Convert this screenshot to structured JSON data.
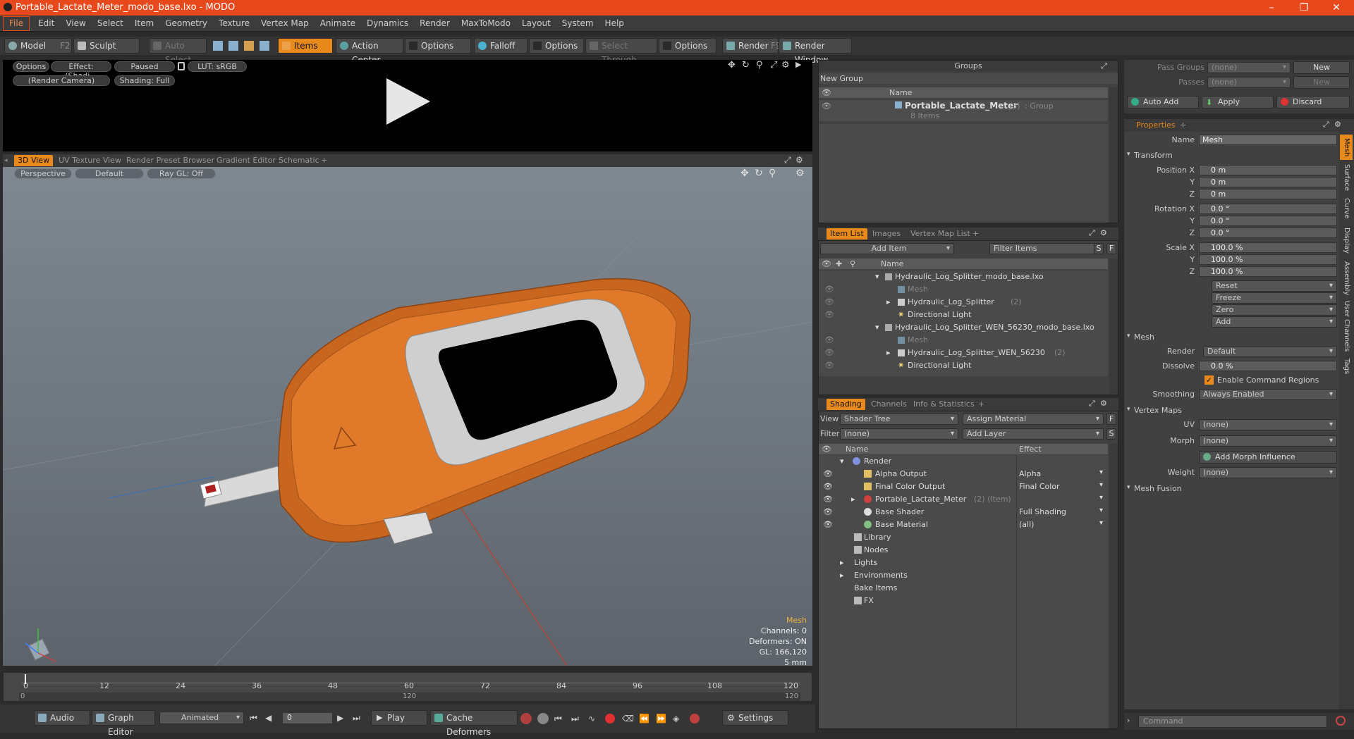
{
  "window": {
    "title": "Portable_Lactate_Meter_modo_base.lxo - MODO"
  },
  "menu": [
    "File",
    "Edit",
    "View",
    "Select",
    "Item",
    "Geometry",
    "Texture",
    "Vertex Map",
    "Animate",
    "Dynamics",
    "Render",
    "MaxToModo",
    "Layout",
    "System",
    "Help"
  ],
  "toolbar": {
    "model": "Model",
    "model_key": "F2",
    "sculpt": "Sculpt",
    "auto_select": "Auto Select",
    "items": "Items",
    "action_center": "Action Center",
    "options1": "Options",
    "falloff": "Falloff",
    "options2": "Options",
    "select_through": "Select Through",
    "options3": "Options",
    "render": "Render",
    "render_key": "F9",
    "render_window": "Render Window"
  },
  "preview": {
    "options": "Options",
    "effect": "Effect: (Shadi...",
    "paused": "Paused",
    "lut": "LUT: sRGB",
    "camera": "(Render Camera)",
    "shading": "Shading: Full"
  },
  "viewtabs": [
    "3D View",
    "UV Texture View",
    "Render Preset Browser",
    "Gradient Editor",
    "Schematic"
  ],
  "viewport": {
    "perspective": "Perspective",
    "default": "Default",
    "raygl": "Ray GL: Off",
    "info": {
      "title": "Mesh",
      "channels": "Channels: 0",
      "deformers": "Deformers: ON",
      "gl": "GL: 166,120",
      "scale": "5 mm"
    }
  },
  "timeline": {
    "ticks": [
      "0",
      "12",
      "24",
      "36",
      "48",
      "60",
      "72",
      "84",
      "96",
      "108",
      "120"
    ],
    "sub_left": "0",
    "sub_mid": "120",
    "sub_right": "120"
  },
  "bottombar": {
    "audio": "Audio",
    "graph": "Graph Editor",
    "animated": "Animated",
    "frame": "0",
    "play": "Play",
    "cache": "Cache Deformers",
    "settings": "Settings"
  },
  "groups": {
    "title": "Groups",
    "new_group": "New Group",
    "col_name": "Name",
    "item_name": "Portable_Lactate_Meter",
    "item_count": "(3)",
    "item_type": ": Group",
    "item_sub": "8 Items"
  },
  "itemlist": {
    "tabs": [
      "Item List",
      "Images",
      "Vertex Map List"
    ],
    "add_item": "Add Item",
    "filter": "Filter Items",
    "s": "S",
    "f": "F",
    "col_name": "Name",
    "rows": [
      {
        "indent": 0,
        "text": "Hydraulic_Log_Splitter_modo_base.lxo",
        "dim": false,
        "arrow": "▾"
      },
      {
        "indent": 1,
        "text": "Mesh",
        "dim": true,
        "arrow": ""
      },
      {
        "indent": 1,
        "text": "Hydraulic_Log_Splitter",
        "dim": false,
        "arrow": "▸",
        "suffix": "(2)"
      },
      {
        "indent": 1,
        "text": "Directional Light",
        "dim": false,
        "arrow": ""
      },
      {
        "indent": 0,
        "text": "Hydraulic_Log_Splitter_WEN_56230_modo_base.lxo",
        "dim": false,
        "arrow": "▾"
      },
      {
        "indent": 1,
        "text": "Mesh",
        "dim": true,
        "arrow": ""
      },
      {
        "indent": 1,
        "text": "Hydraulic_Log_Splitter_WEN_56230",
        "dim": false,
        "arrow": "▸",
        "suffix": "(2)"
      },
      {
        "indent": 1,
        "text": "Directional Light",
        "dim": false,
        "arrow": ""
      }
    ]
  },
  "shading": {
    "tabs": [
      "Shading",
      "Channels",
      "Info & Statistics"
    ],
    "view_label": "View",
    "view_val": "Shader Tree",
    "assign": "Assign Material",
    "f": "F",
    "filter_label": "Filter",
    "filter_val": "(none)",
    "add_layer": "Add Layer",
    "s": "S",
    "col_name": "Name",
    "col_effect": "Effect",
    "rows": [
      {
        "indent": 0,
        "text": "Render",
        "effect": "",
        "arrow": "▾",
        "eye": false
      },
      {
        "indent": 1,
        "text": "Alpha Output",
        "effect": "Alpha",
        "arrow": "",
        "eye": true
      },
      {
        "indent": 1,
        "text": "Final Color Output",
        "effect": "Final Color",
        "arrow": "",
        "eye": true
      },
      {
        "indent": 1,
        "text": "Portable_Lactate_Meter",
        "suffix": "(2) (Item)",
        "effect": "",
        "arrow": "▸",
        "eye": true
      },
      {
        "indent": 1,
        "text": "Base Shader",
        "effect": "Full Shading",
        "arrow": "",
        "eye": true
      },
      {
        "indent": 1,
        "text": "Base Material",
        "effect": "(all)",
        "arrow": "",
        "eye": true
      },
      {
        "indent": 0,
        "text": "Library",
        "effect": "",
        "arrow": "",
        "eye": false
      },
      {
        "indent": 0,
        "text": "Nodes",
        "effect": "",
        "arrow": "",
        "eye": false
      },
      {
        "indent": 0,
        "text": "Lights",
        "effect": "",
        "arrow": "▸",
        "eye": false
      },
      {
        "indent": 0,
        "text": "Environments",
        "effect": "",
        "arrow": "▸",
        "eye": false
      },
      {
        "indent": 0,
        "text": "Bake Items",
        "effect": "",
        "arrow": "",
        "eye": false
      },
      {
        "indent": 0,
        "text": "FX",
        "effect": "",
        "arrow": "",
        "eye": false
      }
    ]
  },
  "passes": {
    "pass_groups": "Pass Groups",
    "passes": "Passes",
    "none": "(none)",
    "new": "New",
    "auto_add": "Auto Add",
    "apply": "Apply",
    "discard": "Discard"
  },
  "properties": {
    "tab": "Properties",
    "name_label": "Name",
    "name_val": "Mesh",
    "transform": "Transform",
    "position": {
      "label": "Position X",
      "y": "Y",
      "z": "Z",
      "vals": [
        "0 m",
        "0 m",
        "0 m"
      ]
    },
    "rotation": {
      "label": "Rotation X",
      "vals": [
        "0.0 °",
        "0.0 °",
        "0.0 °"
      ]
    },
    "scale": {
      "label": "Scale X",
      "vals": [
        "100.0 %",
        "100.0 %",
        "100.0 %"
      ]
    },
    "actions": [
      "Reset",
      "Freeze",
      "Zero",
      "Add"
    ],
    "mesh": "Mesh",
    "render_label": "Render",
    "render_val": "Default",
    "dissolve_label": "Dissolve",
    "dissolve_val": "0.0 %",
    "enable_cmd": "Enable Command Regions",
    "smoothing_label": "Smoothing",
    "smoothing_val": "Always Enabled",
    "vertex_maps": "Vertex Maps",
    "uv_label": "UV",
    "uv_val": "(none)",
    "morph_label": "Morph",
    "morph_val": "(none)",
    "add_morph": "Add Morph Influence",
    "weight_label": "Weight",
    "weight_val": "(none)",
    "mesh_fusion": "Mesh Fusion",
    "side_tabs": [
      "Mesh",
      "Surface",
      "Curve",
      "Display",
      "Assembly",
      "User Channels",
      "Tags"
    ]
  },
  "command": {
    "placeholder": "Command"
  }
}
